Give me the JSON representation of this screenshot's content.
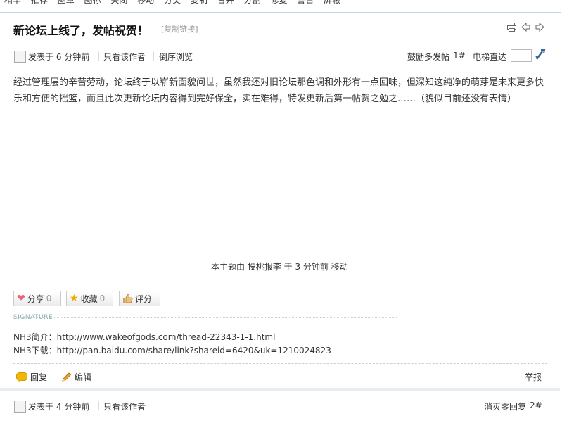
{
  "nav": {
    "items": [
      "精华",
      "推荐",
      "图章",
      "图标",
      "关闭",
      "移动",
      "分类",
      "复制",
      "合并",
      "分割",
      "修复",
      "警告",
      "屏蔽"
    ]
  },
  "thread": {
    "title": "新论坛上线了，发帖祝贺！",
    "copy_link": "[复制链接]"
  },
  "post1": {
    "posted": "发表于 6 分钟前",
    "only_author": "只看该作者",
    "reverse": "倒序浏览",
    "encourage": "鼓励多发帖",
    "floor": "1#",
    "elevator": "电梯直达",
    "elevator_value": "",
    "body": "经过管理层的辛苦劳动，论坛终于以崭新面貌问世，虽然我还对旧论坛那色调和外形有一点回味，但深知这纯净的萌芽是未来更多快乐和方便的摇篮，而且此次更新论坛内容得到完好保全，实在难得，特发更新后第一帖贺之勉之……（貌似目前还没有表情）",
    "moved_note": "本主题由 投桃报李 于 3 分钟前 移动",
    "share_label": "分享",
    "share_count": "0",
    "fav_label": "收藏",
    "fav_count": "0",
    "rate_label": "评分",
    "sig_label": "SIGNATURE",
    "sig_line1": "NH3简介：http://www.wakeofgods.com/thread-22343-1-1.html",
    "sig_line2": "NH3下载：http://pan.baidu.com/share/link?shareid=6420&uk=1210024823",
    "reply": "回复",
    "edit": "编辑",
    "report": "举报"
  },
  "post2": {
    "posted": "发表于 4 分钟前",
    "only_author": "只看该作者",
    "user_tag": "消灭零回复",
    "floor": "2#"
  },
  "colors": {
    "accent": "#336699",
    "border": "#c2d5e3",
    "reply_icon": "#f2b705",
    "share_heart": "#e8667a"
  },
  "icons": [
    "print-icon",
    "prev-thread-icon",
    "next-thread-icon",
    "elevator-go-icon",
    "heart-icon",
    "star-icon",
    "thumb-up-icon",
    "reply-icon",
    "edit-pencil-icon"
  ]
}
